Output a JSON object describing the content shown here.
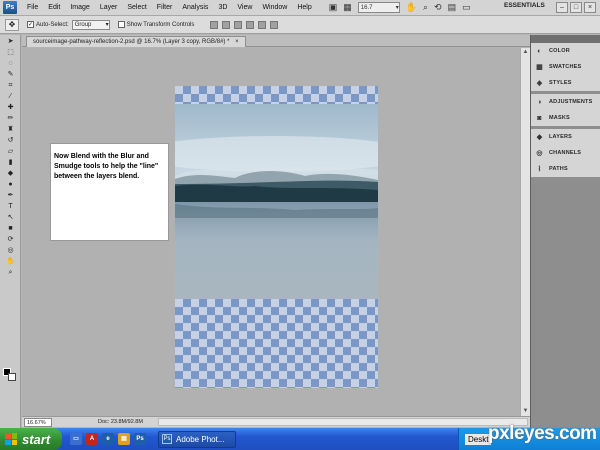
{
  "menubar": {
    "logo": "Ps",
    "items": [
      "File",
      "Edit",
      "Image",
      "Layer",
      "Select",
      "Filter",
      "Analysis",
      "3D",
      "View",
      "Window",
      "Help"
    ],
    "zoom": "16.7",
    "workspace": "ESSENTIALS",
    "window_buttons": [
      "–",
      "□",
      "×"
    ]
  },
  "options": {
    "auto_select_label": "Auto-Select:",
    "auto_select_value": "Group",
    "show_transform_label": "Show Transform Controls"
  },
  "document": {
    "tab_title": "sourceimage-pathway-reflection-2.psd @ 16.7% (Layer 3 copy, RGB/8#) *",
    "close": "×"
  },
  "instruction_text": "Now Blend with the Blur and Smudge tools to help the \"line\" between the layers blend.",
  "statusbar": {
    "zoom": "16.67%",
    "doc_info": "Doc: 23.8M/92.8M"
  },
  "panels": {
    "groups": [
      [
        {
          "icon": "color-icon",
          "label": "COLOR"
        },
        {
          "icon": "swatches-icon",
          "label": "SWATCHES"
        },
        {
          "icon": "styles-icon",
          "label": "STYLES"
        }
      ],
      [
        {
          "icon": "adjustments-icon",
          "label": "ADJUSTMENTS"
        },
        {
          "icon": "masks-icon",
          "label": "MASKS"
        }
      ],
      [
        {
          "icon": "layers-icon",
          "label": "LAYERS"
        },
        {
          "icon": "channels-icon",
          "label": "CHANNELS"
        },
        {
          "icon": "paths-icon",
          "label": "PATHS"
        }
      ]
    ]
  },
  "taskbar": {
    "start": "start",
    "task_button": "Adobe Phot...",
    "tray_label": "Deskt",
    "watermark": "pxleyes.com"
  },
  "colors": {
    "checker_dark": "#7b97c6",
    "checker_light": "#c7d1e5",
    "taskbar_blue": "#2157d0",
    "start_green": "#2f8a2f"
  }
}
